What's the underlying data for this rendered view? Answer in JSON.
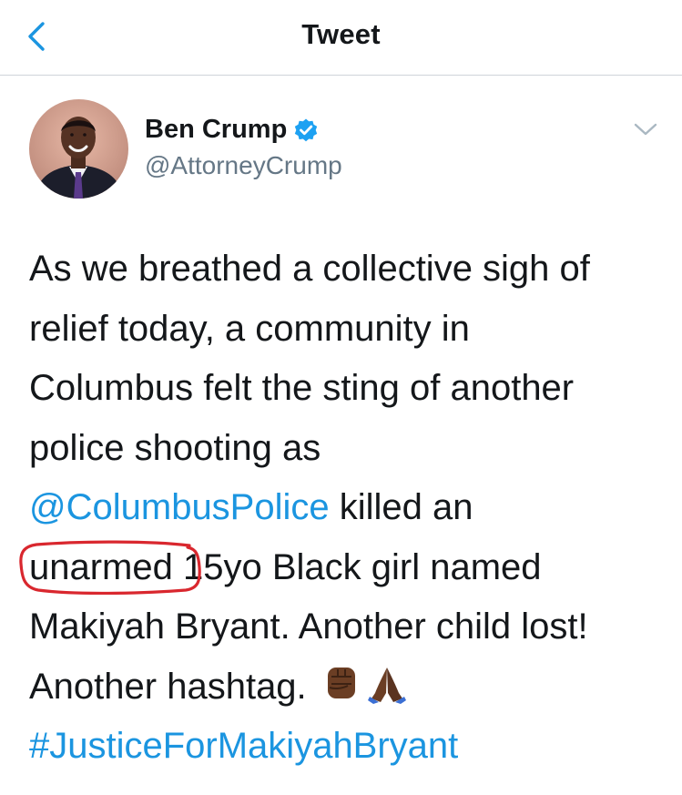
{
  "header": {
    "back_icon": "chevron-left-icon",
    "title": "Tweet"
  },
  "author": {
    "name": "Ben Crump",
    "handle": "@AttorneyCrump",
    "verified": true,
    "verified_icon": "verified-badge-icon",
    "menu_icon": "chevron-down-icon"
  },
  "tweet": {
    "line1": "As we breathed a collective sigh of",
    "line2": "relief today, a community in",
    "line3": "Columbus felt the sting of another",
    "line4": "police shooting as",
    "mention": "@ColumbusPolice",
    "line5_rest": " killed an",
    "circled_word": "unarmed",
    "line6_rest": " 15yo Black girl named",
    "line7": "Makiyah Bryant. Another child lost!",
    "line8": "Another hashtag. ",
    "emoji_1": "raised-fist-dark-skin-icon",
    "emoji_2": "folded-hands-dark-skin-icon",
    "hashtag": "#JusticeForMakiyahBryant"
  },
  "colors": {
    "link": "#1b95e0",
    "text": "#14171a",
    "secondary": "#657786",
    "annotation": "#d9272e"
  }
}
